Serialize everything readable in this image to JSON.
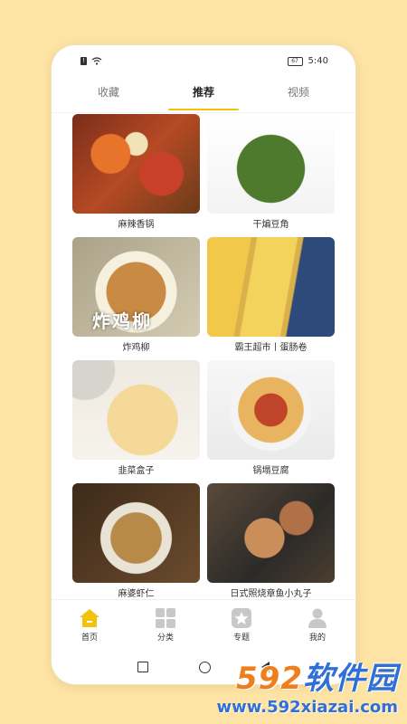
{
  "status": {
    "sim": "!",
    "battery": "67",
    "time": "5:40"
  },
  "tabs": [
    {
      "label": "收藏",
      "active": false
    },
    {
      "label": "推荐",
      "active": true
    },
    {
      "label": "视频",
      "active": false
    }
  ],
  "recipes": [
    {
      "label": "麻辣香锅"
    },
    {
      "label": "干煸豆角"
    },
    {
      "label": "炸鸡柳",
      "image_caption": "炸鸡柳"
    },
    {
      "label": "霸王超市丨蛋肠卷"
    },
    {
      "label": "韭菜盒子"
    },
    {
      "label": "锅塌豆腐"
    },
    {
      "label": "麻婆虾仁"
    },
    {
      "label": "日式照烧章鱼小丸子"
    }
  ],
  "bottom_nav": [
    {
      "label": "首页",
      "icon": "home-icon",
      "active": true
    },
    {
      "label": "分类",
      "icon": "grid-icon",
      "active": false
    },
    {
      "label": "专题",
      "icon": "star-icon",
      "active": false
    },
    {
      "label": "我的",
      "icon": "user-icon",
      "active": false
    }
  ],
  "colors": {
    "accent": "#f4c20d",
    "background": "#fde3a4"
  },
  "watermark": {
    "brand_digits": "592",
    "brand_text": "软件园",
    "url": "www.592xiazai.com"
  }
}
